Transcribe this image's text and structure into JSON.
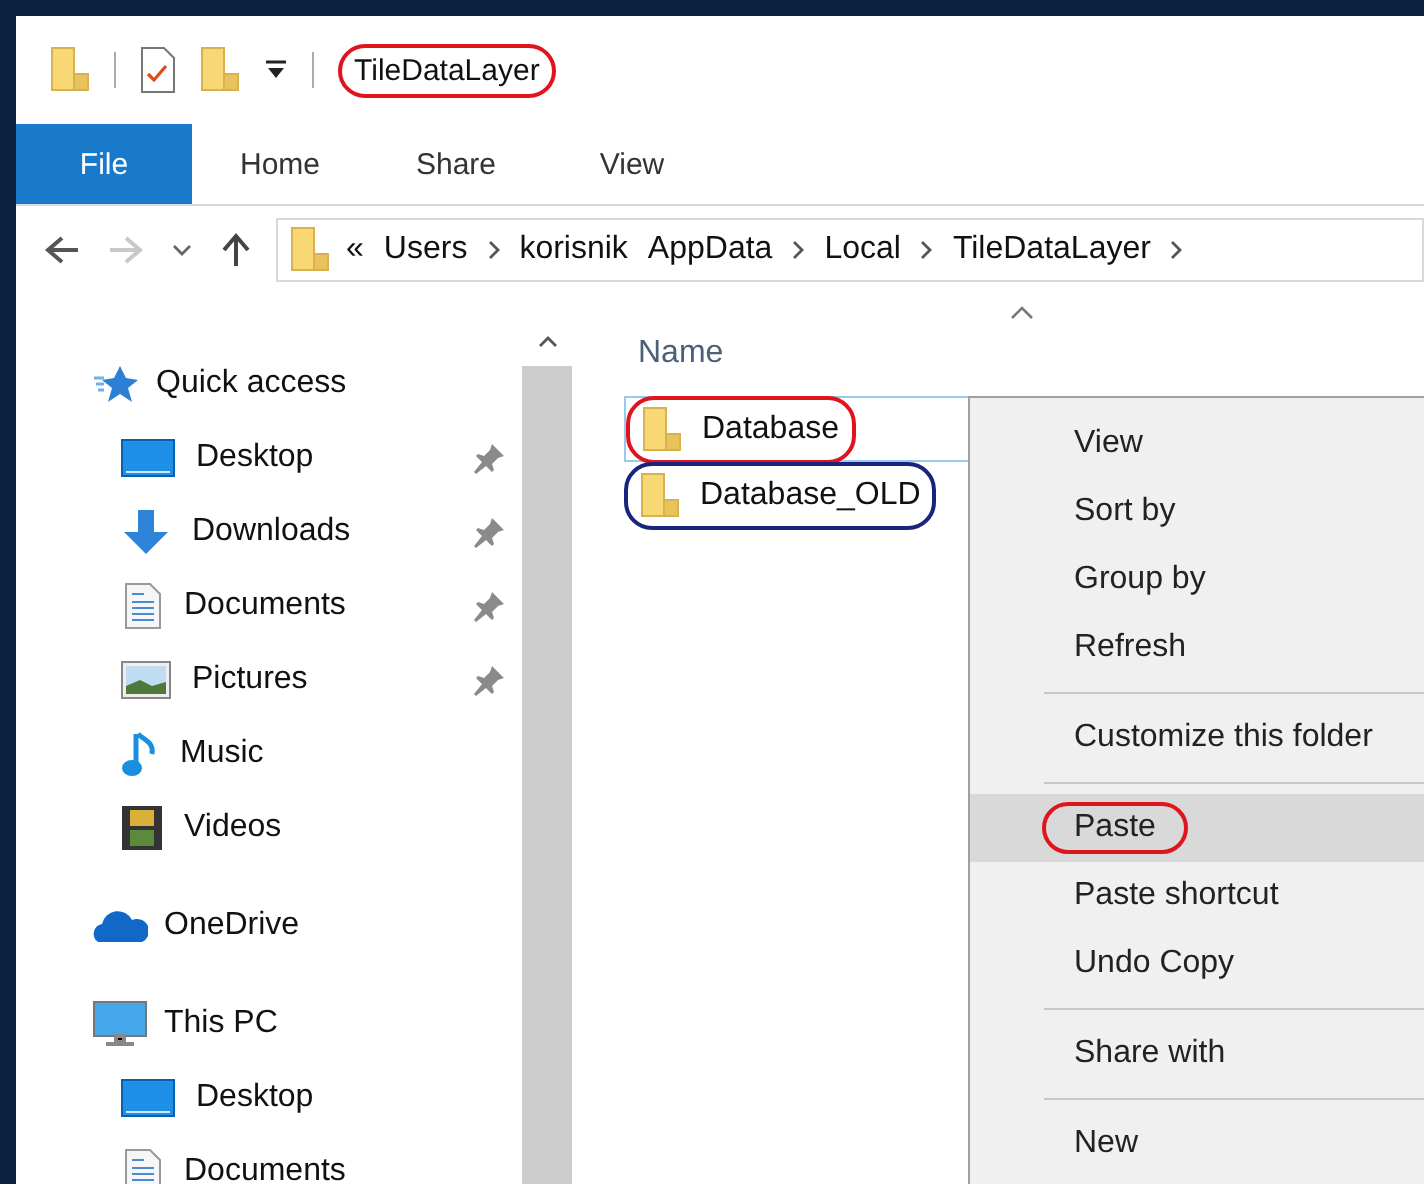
{
  "window": {
    "title": "TileDataLayer",
    "color": "#e0141e"
  },
  "ribbon_tabs": [
    {
      "label": "File",
      "selected": true
    },
    {
      "label": "Home",
      "selected": false
    },
    {
      "label": "Share",
      "selected": false
    },
    {
      "label": "View",
      "selected": false
    }
  ],
  "address": {
    "overflow_marker": "«",
    "segments": [
      {
        "label": "Users",
        "separator_after": true
      },
      {
        "label": "korisnik",
        "separator_after": false
      },
      {
        "label": "AppData",
        "separator_after": true
      },
      {
        "label": "Local",
        "separator_after": true
      },
      {
        "label": "TileDataLayer",
        "separator_after": true
      }
    ]
  },
  "navigation": [
    {
      "label": "Quick access",
      "children": [
        {
          "label": "Desktop",
          "pinned": true
        },
        {
          "label": "Downloads",
          "pinned": true
        },
        {
          "label": "Documents",
          "pinned": true
        },
        {
          "label": "Pictures",
          "pinned": true
        },
        {
          "label": "Music",
          "pinned": false
        },
        {
          "label": "Videos",
          "pinned": false
        }
      ]
    },
    {
      "label": "OneDrive"
    },
    {
      "label": "This PC",
      "children": [
        {
          "label": "Desktop",
          "pinned": false
        },
        {
          "label": "Documents",
          "pinned": false
        }
      ]
    }
  ],
  "content": {
    "column_header": "Name",
    "files": [
      {
        "name": "Database",
        "selected": true,
        "color": "#e0141e"
      },
      {
        "name": "Database_OLD",
        "selected": false,
        "color": "#1a237e"
      }
    ]
  },
  "context_menu": [
    {
      "kind": "item",
      "label": "View",
      "selected": false
    },
    {
      "kind": "item",
      "label": "Sort by",
      "selected": false
    },
    {
      "kind": "item",
      "label": "Group by",
      "selected": false
    },
    {
      "kind": "item",
      "label": "Refresh",
      "selected": false
    },
    {
      "kind": "separator"
    },
    {
      "kind": "item",
      "label": "Customize this folder",
      "selected": false
    },
    {
      "kind": "separator"
    },
    {
      "kind": "item",
      "label": "Paste",
      "selected": true,
      "color": "#e0141e"
    },
    {
      "kind": "item",
      "label": "Paste shortcut",
      "selected": false
    },
    {
      "kind": "item",
      "label": "Undo Copy",
      "selected": false
    },
    {
      "kind": "separator"
    },
    {
      "kind": "item",
      "label": "Share with",
      "selected": false
    },
    {
      "kind": "separator"
    },
    {
      "kind": "item",
      "label": "New",
      "selected": false
    }
  ]
}
